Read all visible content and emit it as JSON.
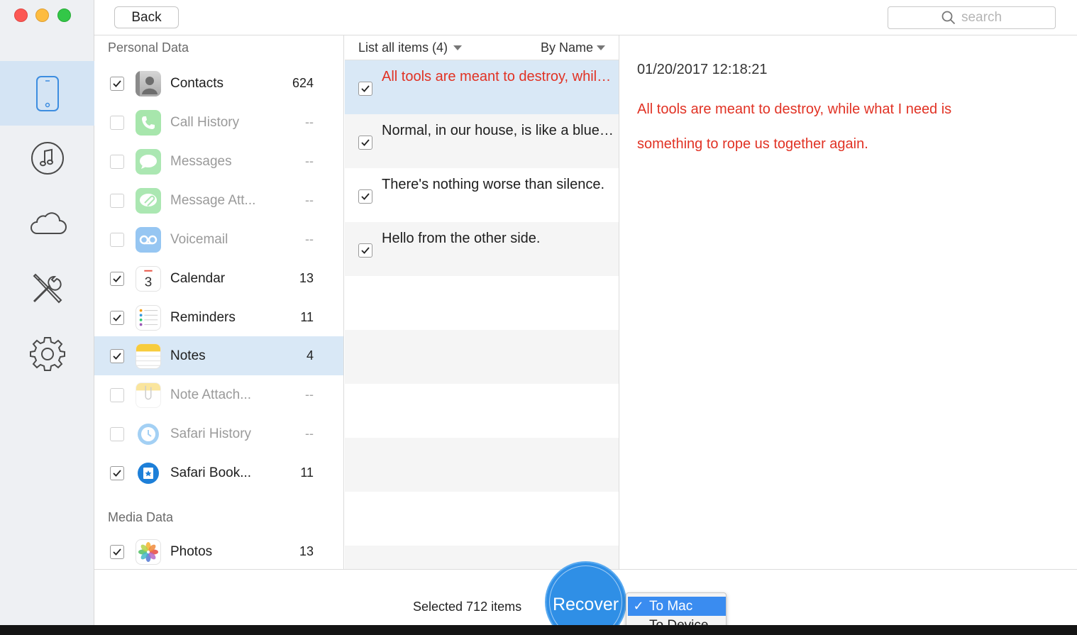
{
  "window": {
    "back_label": "Back",
    "search_placeholder": "search"
  },
  "rail": {
    "items": [
      "device-icon",
      "music-icon",
      "cloud-icon",
      "tools-icon",
      "settings-icon"
    ],
    "active": "device-icon"
  },
  "categories": {
    "personal_header": "Personal Data",
    "media_header": "Media Data",
    "items": [
      {
        "label": "Contacts",
        "count": "624",
        "checked": true,
        "icon": "contacts-icon"
      },
      {
        "label": "Call History",
        "count": "--",
        "checked": false,
        "icon": "phone-icon"
      },
      {
        "label": "Messages",
        "count": "--",
        "checked": false,
        "icon": "messages-icon"
      },
      {
        "label": "Message Att...",
        "count": "--",
        "checked": false,
        "icon": "attachment-icon"
      },
      {
        "label": "Voicemail",
        "count": "--",
        "checked": false,
        "icon": "voicemail-icon"
      },
      {
        "label": "Calendar",
        "count": "13",
        "checked": true,
        "icon": "calendar-icon"
      },
      {
        "label": "Reminders",
        "count": "11",
        "checked": true,
        "icon": "reminders-icon"
      },
      {
        "label": "Notes",
        "count": "4",
        "checked": true,
        "icon": "notes-icon",
        "selected": true
      },
      {
        "label": "Note Attach...",
        "count": "--",
        "checked": false,
        "icon": "note-attachment-icon"
      },
      {
        "label": "Safari History",
        "count": "--",
        "checked": false,
        "icon": "safari-history-icon"
      },
      {
        "label": "Safari Book...",
        "count": "11",
        "checked": true,
        "icon": "safari-bookmarks-icon"
      }
    ],
    "media_items": [
      {
        "label": "Photos",
        "count": "13",
        "checked": true,
        "icon": "photos-icon"
      }
    ]
  },
  "list": {
    "filter_label": "List all items (4)",
    "sort_label": "By Name",
    "notes": [
      {
        "text": "All tools are meant to destroy, while what I need is something to rope us together again.",
        "checked": true,
        "selected": true
      },
      {
        "text": "Normal, in our house, is like a blue moon.",
        "checked": true
      },
      {
        "text": "There's nothing worse than silence.",
        "checked": true
      },
      {
        "text": "Hello from the other side.",
        "checked": true
      }
    ]
  },
  "detail": {
    "date": "01/20/2017 12:18:21",
    "body": "All tools are meant to destroy, while what I need is something to rope us together again."
  },
  "bottom": {
    "selected_text": "Selected 712 items",
    "recover_label": "Recover",
    "options": [
      "To Mac",
      "To Device"
    ],
    "selected_option": "To Mac"
  },
  "colors": {
    "accent": "#2f8fe6",
    "selection": "#d9e8f6",
    "note_red": "#e13224"
  }
}
